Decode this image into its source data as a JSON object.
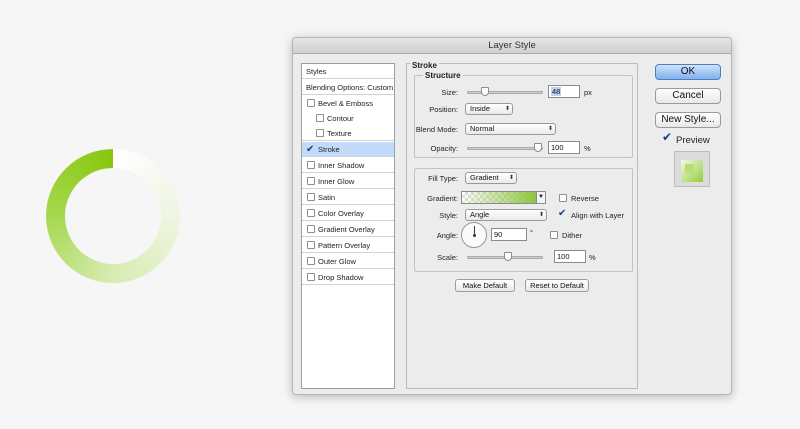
{
  "dialog": {
    "title": "Layer Style"
  },
  "styles_panel": {
    "items": [
      {
        "label": "Styles",
        "has_checkbox": false,
        "checked": false,
        "selected": false
      },
      {
        "label": "Blending Options: Custom",
        "has_checkbox": false,
        "checked": false,
        "selected": false
      },
      {
        "label": "Bevel & Emboss",
        "has_checkbox": true,
        "checked": false,
        "selected": false
      },
      {
        "label": "Contour",
        "has_checkbox": true,
        "checked": false,
        "selected": false
      },
      {
        "label": "Texture",
        "has_checkbox": true,
        "checked": false,
        "selected": false
      },
      {
        "label": "Stroke",
        "has_checkbox": true,
        "checked": true,
        "selected": true
      },
      {
        "label": "Inner Shadow",
        "has_checkbox": true,
        "checked": false,
        "selected": false
      },
      {
        "label": "Inner Glow",
        "has_checkbox": true,
        "checked": false,
        "selected": false
      },
      {
        "label": "Satin",
        "has_checkbox": true,
        "checked": false,
        "selected": false
      },
      {
        "label": "Color Overlay",
        "has_checkbox": true,
        "checked": false,
        "selected": false
      },
      {
        "label": "Gradient Overlay",
        "has_checkbox": true,
        "checked": false,
        "selected": false
      },
      {
        "label": "Pattern Overlay",
        "has_checkbox": true,
        "checked": false,
        "selected": false
      },
      {
        "label": "Outer Glow",
        "has_checkbox": true,
        "checked": false,
        "selected": false
      },
      {
        "label": "Drop Shadow",
        "has_checkbox": true,
        "checked": false,
        "selected": false
      }
    ]
  },
  "stroke": {
    "section_title": "Stroke",
    "structure_title": "Structure",
    "size_label": "Size:",
    "size_value": "48",
    "size_unit": "px",
    "size_slider_fraction": 0.19,
    "position_label": "Position:",
    "position_value": "Inside",
    "blend_mode_label": "Blend Mode:",
    "blend_mode_value": "Normal",
    "opacity_label": "Opacity:",
    "opacity_value": "100",
    "opacity_unit": "%",
    "opacity_slider_fraction": 1.0,
    "fill_type_label": "Fill Type:",
    "fill_type_value": "Gradient",
    "gradient_label": "Gradient:",
    "reverse_label": "Reverse",
    "reverse_checked": false,
    "style_label": "Style:",
    "style_value": "Angle",
    "align_label": "Align with Layer",
    "align_checked": true,
    "angle_label": "Angle:",
    "angle_value": "90",
    "angle_unit": "°",
    "dither_label": "Dither",
    "dither_checked": false,
    "scale_label": "Scale:",
    "scale_value": "100",
    "scale_unit": "%",
    "scale_slider_fraction": 0.55,
    "make_default_label": "Make Default",
    "reset_default_label": "Reset to Default"
  },
  "actions": {
    "ok_label": "OK",
    "cancel_label": "Cancel",
    "new_style_label": "New Style...",
    "preview_label": "Preview",
    "preview_checked": true
  },
  "colors": {
    "accent_green": "#88c70e",
    "selection_blue": "#c2dbfb",
    "default_button": "#7fb0ee"
  },
  "icons": {
    "checkmark": "check-icon",
    "dropdown": "chevron-updown-icon",
    "angle_dial": "angle-dial-icon"
  }
}
